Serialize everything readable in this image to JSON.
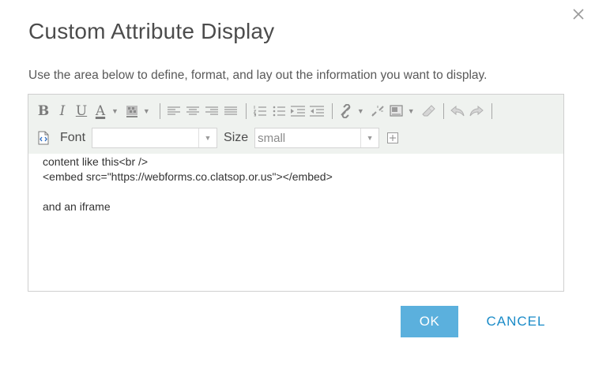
{
  "dialog": {
    "title": "Custom Attribute Display",
    "instructions": "Use the area below to define, format, and lay out the information you want to display.",
    "close_icon": "close-icon"
  },
  "toolbar": {
    "bold": "B",
    "italic": "I",
    "underline": "U",
    "font_color": "A",
    "font_label": "Font",
    "font_value": "",
    "size_label": "Size",
    "size_value": "small",
    "icons": [
      "bold-icon",
      "italic-icon",
      "underline-icon",
      "font-color-icon",
      "highlight-icon",
      "align-left-icon",
      "align-center-icon",
      "align-right-icon",
      "justify-icon",
      "numbered-list-icon",
      "bullet-list-icon",
      "indent-icon",
      "outdent-icon",
      "link-icon",
      "unlink-icon",
      "image-icon",
      "eraser-icon",
      "undo-icon",
      "redo-icon",
      "view-source-icon",
      "expand-icon"
    ]
  },
  "editor": {
    "content": "content like this<br />\n<embed src=\"https://webforms.co.clatsop.or.us\"></embed>\n\nand an iframe"
  },
  "buttons": {
    "ok": "OK",
    "cancel": "CANCEL"
  },
  "colors": {
    "accent": "#5bb0dd",
    "link": "#1a8bc8",
    "toolbar_bg": "#eff2ef"
  }
}
